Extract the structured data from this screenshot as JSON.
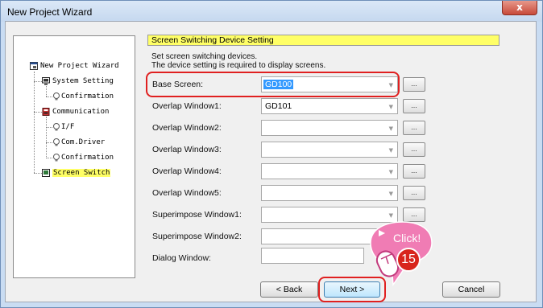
{
  "window": {
    "title": "New Project Wizard",
    "close_glyph": "x"
  },
  "tree": {
    "items": [
      {
        "label": "New Project Wizard",
        "icon": "wizard-icon"
      },
      {
        "label": "System Setting",
        "icon": "monitor-icon"
      },
      {
        "label": "Confirmation",
        "icon": "bulb-icon"
      },
      {
        "label": "Communication",
        "icon": "device-icon"
      },
      {
        "label": "I/F",
        "icon": "bulb-icon"
      },
      {
        "label": "Com.Driver",
        "icon": "bulb-icon"
      },
      {
        "label": "Confirmation",
        "icon": "bulb-icon"
      },
      {
        "label": "Screen Switch",
        "icon": "screen-icon"
      }
    ]
  },
  "panel": {
    "header": "Screen Switching Device Setting",
    "desc_line1": "Set screen switching devices.",
    "desc_line2": "The device setting is required to display screens.",
    "rows": [
      {
        "label": "Base Screen:",
        "value": "GD100"
      },
      {
        "label": "Overlap Window1:",
        "value": "GD101"
      },
      {
        "label": "Overlap Window2:",
        "value": ""
      },
      {
        "label": "Overlap Window3:",
        "value": ""
      },
      {
        "label": "Overlap Window4:",
        "value": ""
      },
      {
        "label": "Overlap Window5:",
        "value": ""
      },
      {
        "label": "Superimpose Window1:",
        "value": ""
      },
      {
        "label": "Superimpose Window2:",
        "value": ""
      },
      {
        "label": "Dialog Window:",
        "value": ""
      }
    ],
    "dots_label": "..."
  },
  "buttons": {
    "back": "< Back",
    "next": "Next >",
    "cancel": "Cancel"
  },
  "callout": {
    "text": "Click!",
    "step": "15"
  },
  "colors": {
    "highlight": "#ffff66",
    "annotation_red": "#e02020",
    "callout_pink": "#f07cb4",
    "step_red": "#d8261c",
    "selection_blue": "#3399ff"
  }
}
